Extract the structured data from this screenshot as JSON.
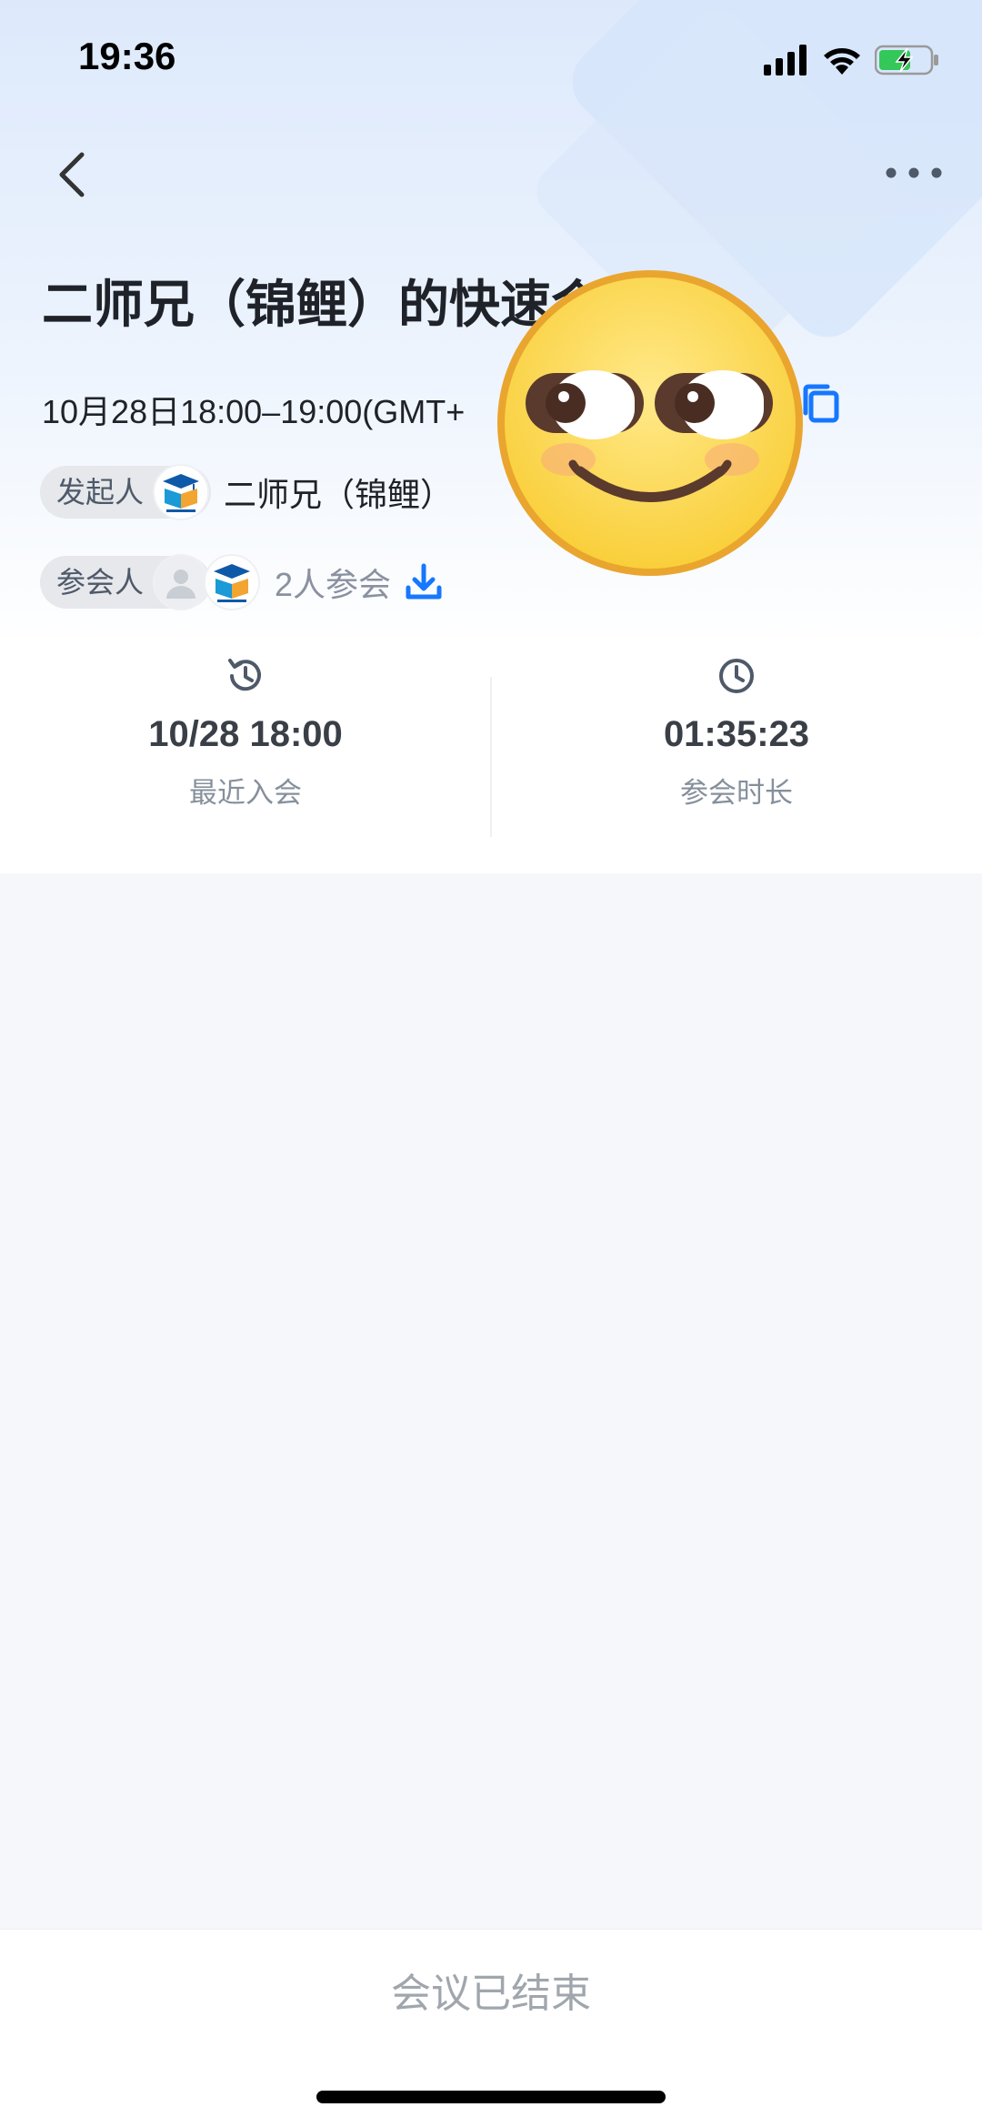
{
  "status_bar": {
    "time": "19:36"
  },
  "meeting": {
    "title": "二师兄（锦鲤）的快速会",
    "datetime": "10月28日18:00–19:00(GMT+",
    "organizer_label": "发起人",
    "organizer_name": "二师兄（锦鲤）",
    "participants_label": "参会人",
    "participants_count": "2人参会"
  },
  "stats": {
    "last_join_value": "10/28 18:00",
    "last_join_label": "最近入会",
    "duration_value": "01:35:23",
    "duration_label": "参会时长"
  },
  "footer": {
    "status_text": "会议已结束"
  },
  "colors": {
    "accent": "#1677ff",
    "title": "#1f2329",
    "muted": "#86909c"
  }
}
